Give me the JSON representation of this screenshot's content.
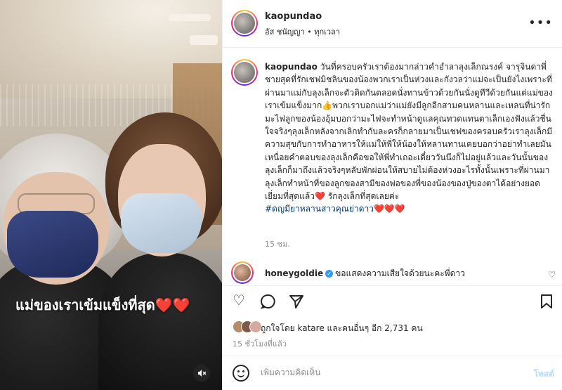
{
  "photo": {
    "caption": "แม่ของเราเข้มแข็งที่สุด",
    "caption_hearts": "❤️❤️",
    "mute_icon": "speaker-muted-icon"
  },
  "header": {
    "username": "kaopundao",
    "subtitle": "อัส ชนัญญา • ทุกเวลา",
    "more_icon": "•••"
  },
  "caption": {
    "username": "kaopundao",
    "text_1": " วันที่ครอบครัวเราต้องมากล่าวคำอำลาลุงเล็กณรงค์ จารุจินดาพี่ชายสุดที่รักเชฟมิชลินของน้องพวกเราเป็นห่วงและกังวลว่าแม่จะเป็นยังไงเพราะที่ผ่านมาแม่กับลุงเล็กจะตัวติดกันตลอดนั่งทานข้าวด้วยกันนั่งดูทีวีด้วยกันแต่แม่ของเราเข้มแข็งมาก",
    "thumb": "👍",
    "text_2": "พวกเราบอกแม่ว่าแม่ยังมีลูกอีกสามคนหลานและเหลนที่น่ารักมะไฟลูกของน้องอุ้มบอกว่ามะไฟจะทำหน้าดูแลคุณทวดแทนตาเล็กเองฟังแล้วชื่นใจจริงๆลุงเล็กหลังจากเลิกทำกับละครก็กลายมาเป็นเชฟของครอบครัวเราลุงเล็กมีความสุขกับการทำอาหารให้แม่ให้พี่ให้น้องให้หลานทานเคยบอกว่าอย่าทำเลยมันเหนื่อยคำตอบของลุงเล็กคือขอให้พี่ทำเถอะเดี๋ยววันนึงก็ไม่อยู่แล้วและวันนั้นของลุงเล็กก็มาถึงแล้วจริงๆหลับพักผ่อนให้สบายไม่ต้องห่วงอะไรทั้งนั้นเพราะที่ผ่านมาลุงเล็กทำหน้าที่ของลูกของสามีของพ่อของพี่ของน้องของปู่ของตาได้อย่างยอดเยี่ยมที่สุดแล้ว",
    "heart_1": "❤️",
    "text_3": " รักลุงเล็กที่สุดเลยค่ะ",
    "hashtag": "#ดญมียาหลานสาวคุณย่าดาว",
    "hearts_end": "❤️❤️❤️",
    "time": "15 ชม."
  },
  "comment": {
    "username": "honeygoldie",
    "text": "ขอแสดงความเสียใจด้วยนะคะพี่ดาว"
  },
  "actions": {
    "like_icon": "♡",
    "comment_icon": "◯",
    "share_icon": "➤",
    "save_icon": "⊓"
  },
  "likes": {
    "text": "ถูกใจโดย katare และคนอื่นๆ อีก 2,731 คน",
    "time": "15 ชั่วโมงที่แล้ว"
  },
  "add_comment": {
    "placeholder": "เพิ่มความคิดเห็น",
    "post_label": "โพสต์"
  }
}
